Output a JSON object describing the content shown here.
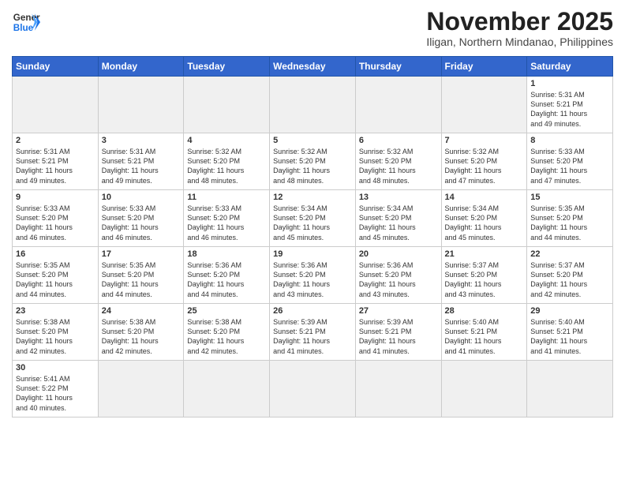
{
  "header": {
    "logo_line1": "General",
    "logo_line2": "Blue",
    "month_title": "November 2025",
    "location": "Iligan, Northern Mindanao, Philippines"
  },
  "weekdays": [
    "Sunday",
    "Monday",
    "Tuesday",
    "Wednesday",
    "Thursday",
    "Friday",
    "Saturday"
  ],
  "weeks": [
    [
      {
        "day": "",
        "info": "",
        "empty": true
      },
      {
        "day": "",
        "info": "",
        "empty": true
      },
      {
        "day": "",
        "info": "",
        "empty": true
      },
      {
        "day": "",
        "info": "",
        "empty": true
      },
      {
        "day": "",
        "info": "",
        "empty": true
      },
      {
        "day": "",
        "info": "",
        "empty": true
      },
      {
        "day": "1",
        "info": "Sunrise: 5:31 AM\nSunset: 5:21 PM\nDaylight: 11 hours\nand 49 minutes."
      }
    ],
    [
      {
        "day": "2",
        "info": "Sunrise: 5:31 AM\nSunset: 5:21 PM\nDaylight: 11 hours\nand 49 minutes."
      },
      {
        "day": "3",
        "info": "Sunrise: 5:31 AM\nSunset: 5:21 PM\nDaylight: 11 hours\nand 49 minutes."
      },
      {
        "day": "4",
        "info": "Sunrise: 5:32 AM\nSunset: 5:20 PM\nDaylight: 11 hours\nand 48 minutes."
      },
      {
        "day": "5",
        "info": "Sunrise: 5:32 AM\nSunset: 5:20 PM\nDaylight: 11 hours\nand 48 minutes."
      },
      {
        "day": "6",
        "info": "Sunrise: 5:32 AM\nSunset: 5:20 PM\nDaylight: 11 hours\nand 48 minutes."
      },
      {
        "day": "7",
        "info": "Sunrise: 5:32 AM\nSunset: 5:20 PM\nDaylight: 11 hours\nand 47 minutes."
      },
      {
        "day": "8",
        "info": "Sunrise: 5:33 AM\nSunset: 5:20 PM\nDaylight: 11 hours\nand 47 minutes."
      }
    ],
    [
      {
        "day": "9",
        "info": "Sunrise: 5:33 AM\nSunset: 5:20 PM\nDaylight: 11 hours\nand 46 minutes."
      },
      {
        "day": "10",
        "info": "Sunrise: 5:33 AM\nSunset: 5:20 PM\nDaylight: 11 hours\nand 46 minutes."
      },
      {
        "day": "11",
        "info": "Sunrise: 5:33 AM\nSunset: 5:20 PM\nDaylight: 11 hours\nand 46 minutes."
      },
      {
        "day": "12",
        "info": "Sunrise: 5:34 AM\nSunset: 5:20 PM\nDaylight: 11 hours\nand 45 minutes."
      },
      {
        "day": "13",
        "info": "Sunrise: 5:34 AM\nSunset: 5:20 PM\nDaylight: 11 hours\nand 45 minutes."
      },
      {
        "day": "14",
        "info": "Sunrise: 5:34 AM\nSunset: 5:20 PM\nDaylight: 11 hours\nand 45 minutes."
      },
      {
        "day": "15",
        "info": "Sunrise: 5:35 AM\nSunset: 5:20 PM\nDaylight: 11 hours\nand 44 minutes."
      }
    ],
    [
      {
        "day": "16",
        "info": "Sunrise: 5:35 AM\nSunset: 5:20 PM\nDaylight: 11 hours\nand 44 minutes."
      },
      {
        "day": "17",
        "info": "Sunrise: 5:35 AM\nSunset: 5:20 PM\nDaylight: 11 hours\nand 44 minutes."
      },
      {
        "day": "18",
        "info": "Sunrise: 5:36 AM\nSunset: 5:20 PM\nDaylight: 11 hours\nand 44 minutes."
      },
      {
        "day": "19",
        "info": "Sunrise: 5:36 AM\nSunset: 5:20 PM\nDaylight: 11 hours\nand 43 minutes."
      },
      {
        "day": "20",
        "info": "Sunrise: 5:36 AM\nSunset: 5:20 PM\nDaylight: 11 hours\nand 43 minutes."
      },
      {
        "day": "21",
        "info": "Sunrise: 5:37 AM\nSunset: 5:20 PM\nDaylight: 11 hours\nand 43 minutes."
      },
      {
        "day": "22",
        "info": "Sunrise: 5:37 AM\nSunset: 5:20 PM\nDaylight: 11 hours\nand 42 minutes."
      }
    ],
    [
      {
        "day": "23",
        "info": "Sunrise: 5:38 AM\nSunset: 5:20 PM\nDaylight: 11 hours\nand 42 minutes."
      },
      {
        "day": "24",
        "info": "Sunrise: 5:38 AM\nSunset: 5:20 PM\nDaylight: 11 hours\nand 42 minutes."
      },
      {
        "day": "25",
        "info": "Sunrise: 5:38 AM\nSunset: 5:20 PM\nDaylight: 11 hours\nand 42 minutes."
      },
      {
        "day": "26",
        "info": "Sunrise: 5:39 AM\nSunset: 5:21 PM\nDaylight: 11 hours\nand 41 minutes."
      },
      {
        "day": "27",
        "info": "Sunrise: 5:39 AM\nSunset: 5:21 PM\nDaylight: 11 hours\nand 41 minutes."
      },
      {
        "day": "28",
        "info": "Sunrise: 5:40 AM\nSunset: 5:21 PM\nDaylight: 11 hours\nand 41 minutes."
      },
      {
        "day": "29",
        "info": "Sunrise: 5:40 AM\nSunset: 5:21 PM\nDaylight: 11 hours\nand 41 minutes."
      }
    ],
    [
      {
        "day": "30",
        "info": "Sunrise: 5:41 AM\nSunset: 5:22 PM\nDaylight: 11 hours\nand 40 minutes."
      },
      {
        "day": "",
        "info": "",
        "empty": true
      },
      {
        "day": "",
        "info": "",
        "empty": true
      },
      {
        "day": "",
        "info": "",
        "empty": true
      },
      {
        "day": "",
        "info": "",
        "empty": true
      },
      {
        "day": "",
        "info": "",
        "empty": true
      },
      {
        "day": "",
        "info": "",
        "empty": true
      }
    ]
  ]
}
